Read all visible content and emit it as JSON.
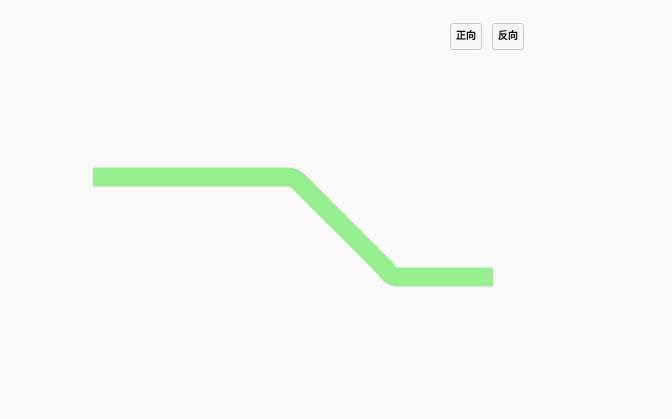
{
  "controls": {
    "forward_label": "正向",
    "reverse_label": "反向"
  },
  "path": {
    "stroke_color": "#96ef8f",
    "background_color": "#f9f9f9"
  }
}
